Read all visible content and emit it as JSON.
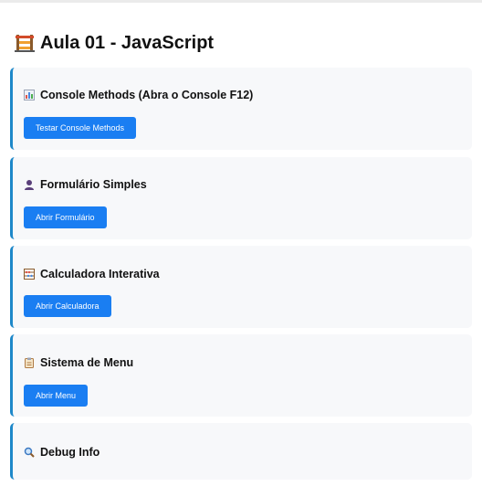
{
  "page": {
    "title": "Aula 01 - JavaScript",
    "title_icon": "construction-icon"
  },
  "sections": [
    {
      "title": "Console Methods (Abra o Console F12)",
      "icon": "bar-chart-icon",
      "button_label": "Testar Console Methods"
    },
    {
      "title": "Formulário Simples",
      "icon": "user-silhouette-icon",
      "button_label": "Abrir Formulário"
    },
    {
      "title": "Calculadora Interativa",
      "icon": "abacus-icon",
      "button_label": "Abrir Calculadora"
    },
    {
      "title": "Sistema de Menu",
      "icon": "clipboard-icon",
      "button_label": "Abrir Menu"
    },
    {
      "title": "Debug Info",
      "icon": "magnifier-icon"
    }
  ],
  "colors": {
    "button": "#1a7ef2",
    "section_border": "#1e88c9",
    "section_background": "#f7f8fa"
  }
}
